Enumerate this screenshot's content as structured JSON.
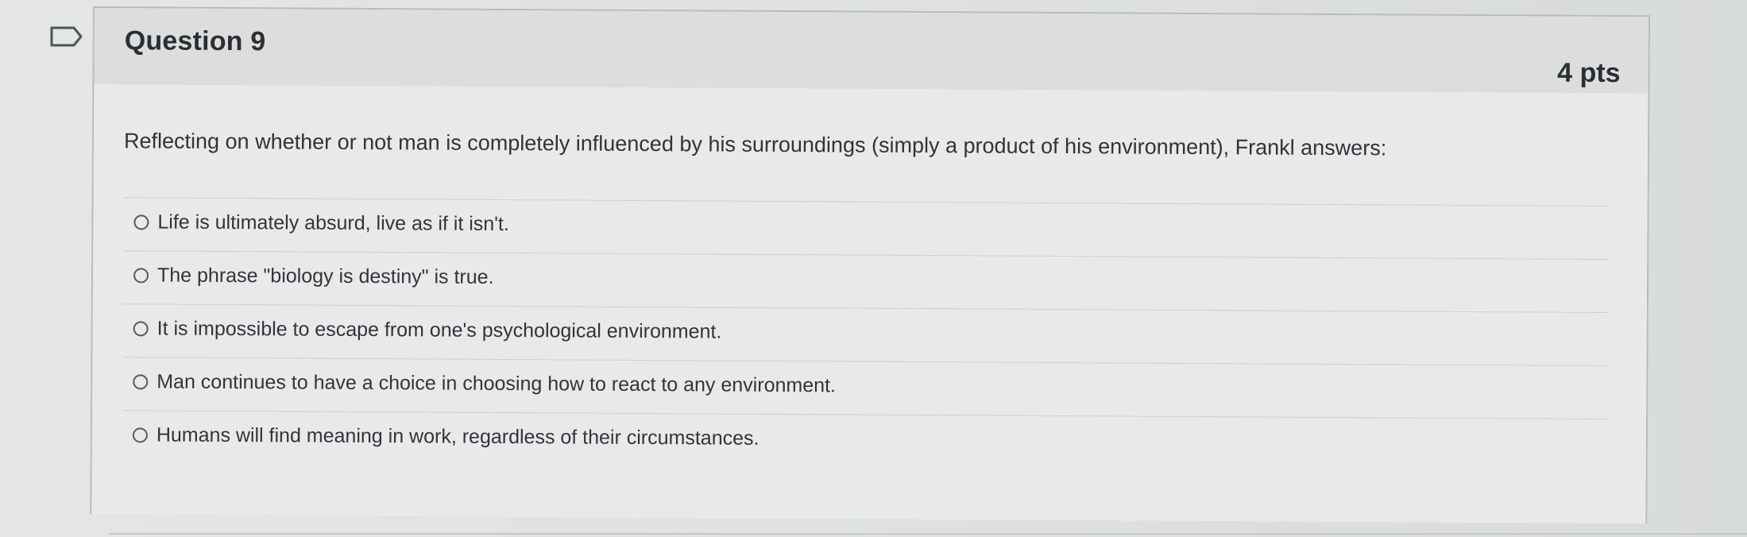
{
  "question": {
    "title": "Question 9",
    "points": "4 pts",
    "prompt": "Reflecting on whether or not man is completely influenced by his surroundings (simply a product of his environment), Frankl answers:",
    "flag_icon": "flag-outline-icon",
    "answers": [
      {
        "label": "Life is ultimately absurd, live as if it isn't.",
        "selected": false
      },
      {
        "label": "The phrase \"biology is destiny\" is true.",
        "selected": false
      },
      {
        "label": "It is impossible to escape from one's psychological environment.",
        "selected": false
      },
      {
        "label": "Man continues to have a choice in choosing how to react to any environment.",
        "selected": false
      },
      {
        "label": "Humans will find meaning in work, regardless of their circumstances.",
        "selected": false
      }
    ]
  },
  "colors": {
    "background": "#d9dcdb",
    "card": "#e8eae9",
    "header": "#dcdedd",
    "border": "#b8bbbd",
    "text": "#2c3134"
  }
}
